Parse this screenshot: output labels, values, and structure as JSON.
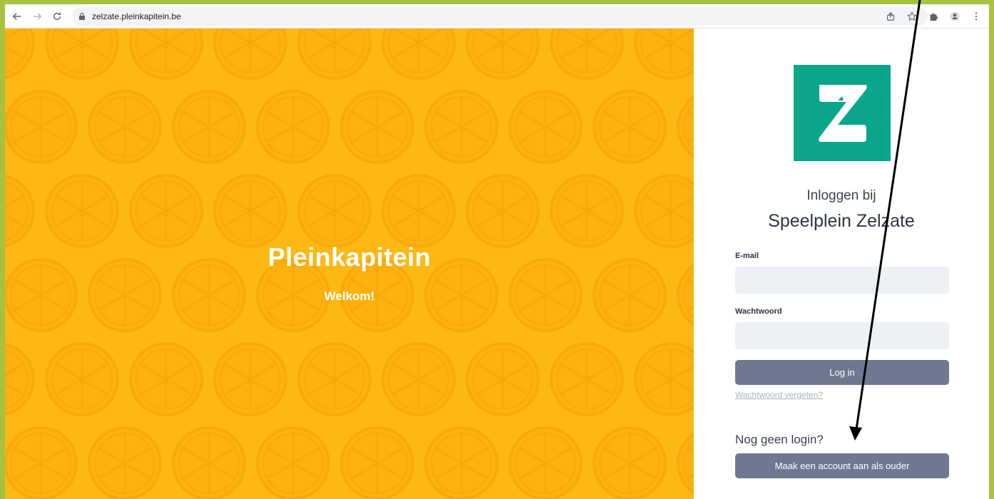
{
  "browser": {
    "url": "zelzate.pleinkapitein.be"
  },
  "hero": {
    "title": "Pleinkapitein",
    "subtitle": "Welkom!",
    "background_color": "#fdb813"
  },
  "login": {
    "logo_letter": "Z",
    "logo_color": "#0aa58a",
    "heading_pre": "Inloggen bij",
    "heading_org": "Speelplein Zelzate",
    "email_label": "E-mail",
    "email_value": "",
    "password_label": "Wachtwoord",
    "password_value": "",
    "login_button": "Log in",
    "forgot_link": "Wachtwoord vergeten?",
    "no_login_text": "Nog geen login?",
    "create_account_button": "Maak een account aan als ouder",
    "button_color": "#6e7991"
  },
  "icons": {
    "back": "back-arrow-icon",
    "forward": "forward-arrow-icon",
    "reload": "reload-icon",
    "lock": "lock-icon",
    "share": "share-icon",
    "bookmark": "star-icon",
    "extensions": "puzzle-icon",
    "profile": "profile-icon",
    "menu": "kebab-menu-icon"
  }
}
